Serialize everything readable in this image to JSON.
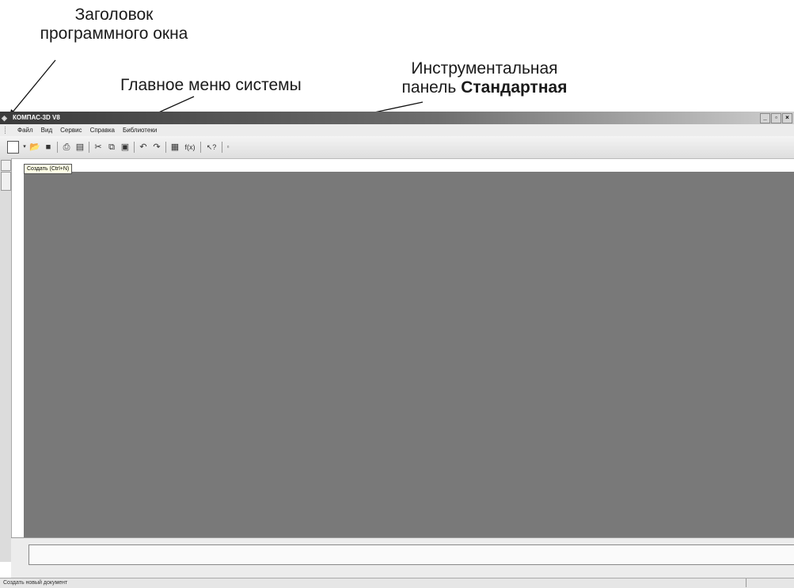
{
  "annotations": {
    "window_title_label": [
      "Заголовок",
      "программного окна"
    ],
    "main_menu_label": "Главное меню системы",
    "toolbar_label_line1": "Инструментальная",
    "toolbar_label_prefix": "панель ",
    "toolbar_label_bold": "Стандартная"
  },
  "window": {
    "title": "КОМПАС-3D V8",
    "controls": [
      "_",
      "▫",
      "×"
    ]
  },
  "menu": {
    "items": [
      "Файл",
      "Вид",
      "Сервис",
      "Справка",
      "Библиотеки"
    ]
  },
  "toolbar": {
    "tooltip": "Создать (Ctrl+N)",
    "buttons": [
      {
        "name": "new-document-icon",
        "glyph": ""
      },
      {
        "name": "dropdown-arrow-icon",
        "glyph": "▾"
      },
      {
        "name": "open-folder-icon",
        "glyph": "📂"
      },
      {
        "name": "save-icon",
        "glyph": "■"
      },
      {
        "name": "print-icon",
        "glyph": "⎙"
      },
      {
        "name": "preview-icon",
        "glyph": "▤"
      },
      {
        "name": "cut-icon",
        "glyph": "✂"
      },
      {
        "name": "copy-icon",
        "glyph": "⧉"
      },
      {
        "name": "paste-icon",
        "glyph": "▣"
      },
      {
        "name": "undo-icon",
        "glyph": "↶"
      },
      {
        "name": "redo-icon",
        "glyph": "↷"
      },
      {
        "name": "manager-icon",
        "glyph": "▦"
      },
      {
        "name": "function-icon",
        "glyph": "f(x)"
      },
      {
        "name": "help-pointer-icon",
        "glyph": "↖?"
      }
    ]
  },
  "status": {
    "text": "Создать новый документ"
  },
  "colors": {
    "workspace": "#797979",
    "titlebar_dark": "#3a3a3a"
  }
}
